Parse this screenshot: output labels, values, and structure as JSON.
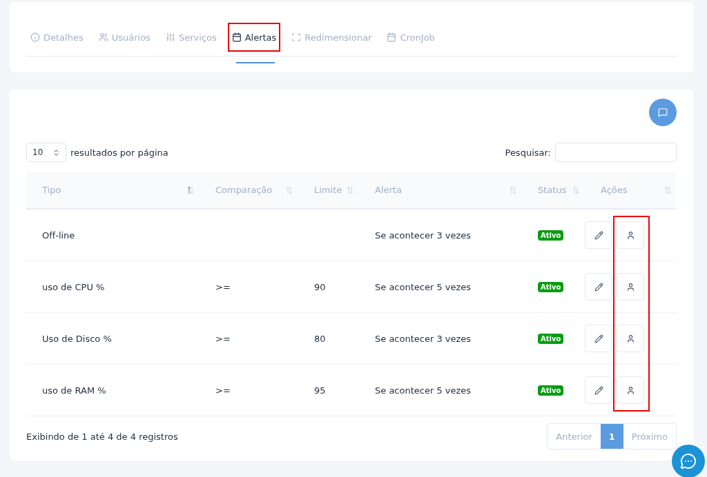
{
  "tabs": [
    {
      "label": "Detalhes",
      "selected": false,
      "highlighted": false
    },
    {
      "label": "Usuários",
      "selected": false,
      "highlighted": false
    },
    {
      "label": "Serviços",
      "selected": false,
      "highlighted": false
    },
    {
      "label": "Alertas",
      "selected": true,
      "highlighted": true
    },
    {
      "label": "Redimensionar",
      "selected": false,
      "highlighted": false
    },
    {
      "label": "CronJob",
      "selected": false,
      "highlighted": false
    }
  ],
  "page_size": {
    "value": "10",
    "label": "resultados por página"
  },
  "search": {
    "label": "Pesquisar:"
  },
  "table": {
    "columns": [
      {
        "label": "Tipo",
        "sorted": true
      },
      {
        "label": "Comparação",
        "sorted": false
      },
      {
        "label": "Limite",
        "sorted": false
      },
      {
        "label": "Alerta",
        "sorted": false
      },
      {
        "label": "Status",
        "sorted": false
      },
      {
        "label": "Ações",
        "sorted": false
      }
    ],
    "user_buttons_highlighted": true,
    "rows": [
      {
        "tipo": "Off-line",
        "comparacao": "",
        "limite": "",
        "alerta": "Se acontecer 3 vezes",
        "status": "Ativo",
        "active": true
      },
      {
        "tipo": "uso de CPU %",
        "comparacao": ">=",
        "limite": "90",
        "alerta": "Se acontecer 5 vezes",
        "status": "Ativo",
        "active": true
      },
      {
        "tipo": "Uso de Disco %",
        "comparacao": ">=",
        "limite": "80",
        "alerta": "Se acontecer 3 vezes",
        "status": "Ativo",
        "active": true
      },
      {
        "tipo": "uso de RAM %",
        "comparacao": ">=",
        "limite": "95",
        "alerta": "Se acontecer 5 vezes",
        "status": "Ativo",
        "active": true
      }
    ]
  },
  "footer": {
    "info": "Exibindo de 1 até 4 de 4 registros"
  },
  "pagination": [
    {
      "label": "Anterior",
      "kind": "nav",
      "selected": false
    },
    {
      "label": "1",
      "kind": "page",
      "selected": true
    },
    {
      "label": "Próximo",
      "kind": "nav",
      "selected": false
    }
  ]
}
